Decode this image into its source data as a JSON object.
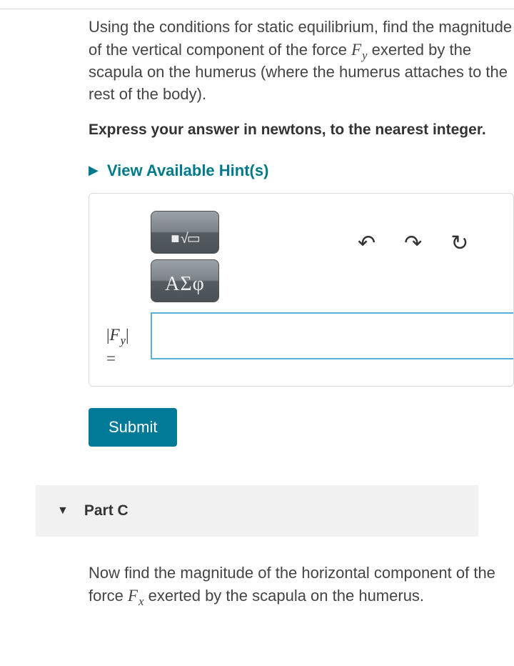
{
  "partB": {
    "text1": "Using the conditions for static equilibrium, find the magnitude of the vertical component of the force ",
    "force_symbol": "F",
    "force_sub": "y",
    "text2": " exerted by the scapula on the humerus (where the humerus attaches to the rest of the body).",
    "instruction": "Express your answer in newtons, to the nearest integer.",
    "hints_label": "View Available Hint(s)",
    "eq_toolbar": "■ √▭",
    "greek_toolbar": "ΑΣφ",
    "lhs_abs_open": "|",
    "lhs_F": "F",
    "lhs_sub": "y",
    "lhs_abs_close": "|",
    "lhs_eq": "=",
    "submit_label": "Submit"
  },
  "partC": {
    "title": "Part C",
    "text1": "Now find the magnitude of the horizontal component of the force ",
    "force_symbol": "F",
    "force_sub": "x",
    "text2": " exerted by the scapula on the humerus."
  }
}
